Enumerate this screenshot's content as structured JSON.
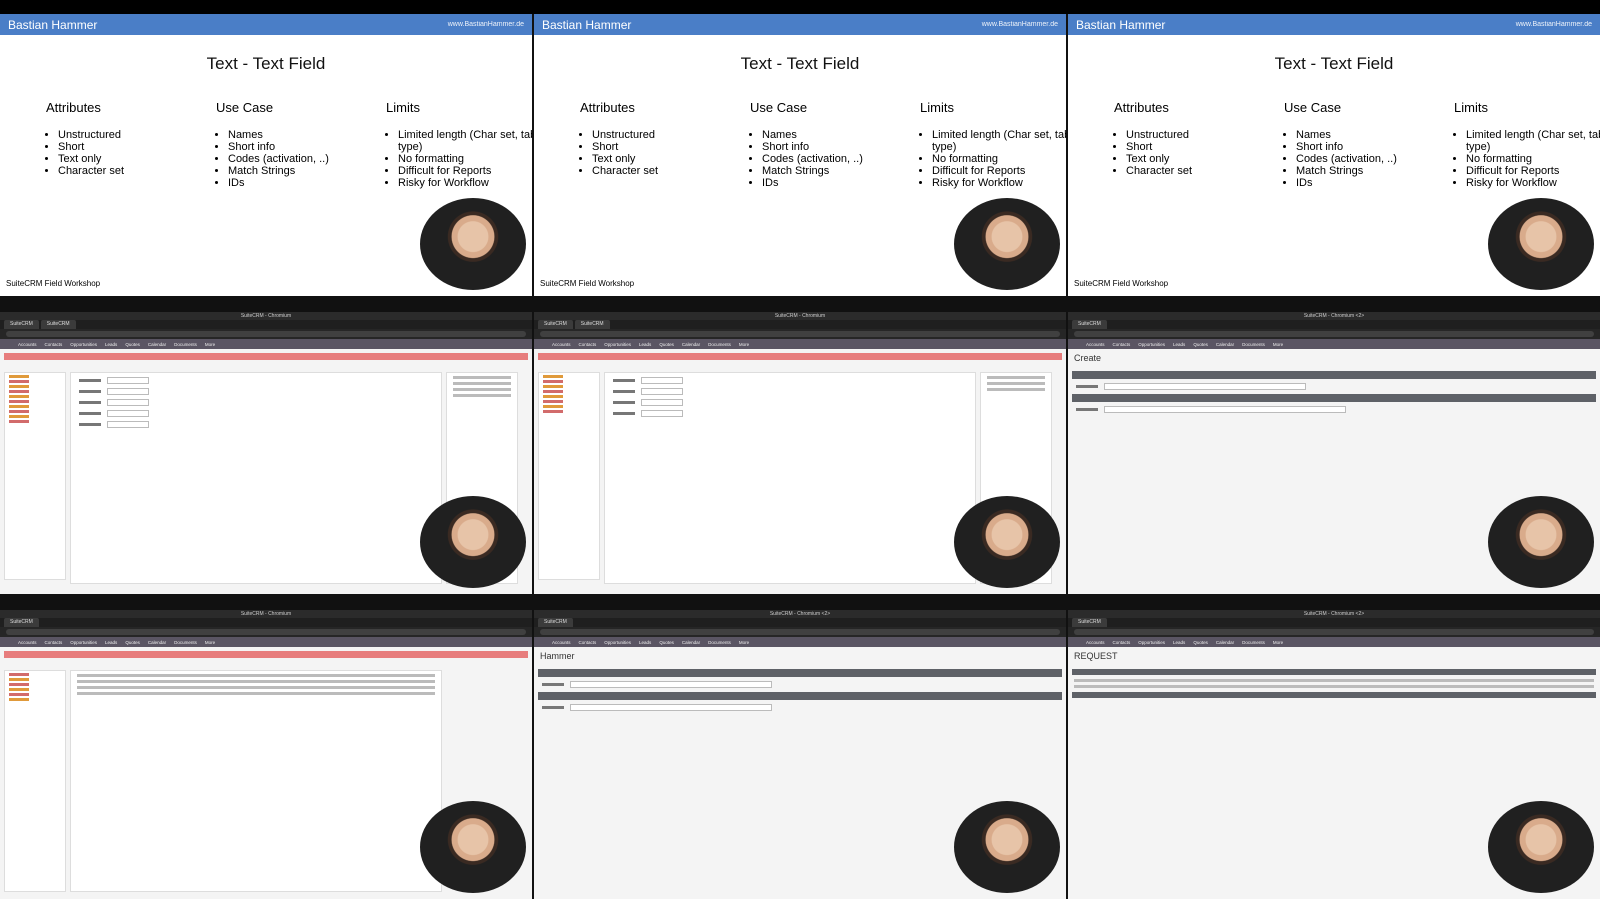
{
  "slides": [
    {
      "brand": "Bastian Hammer",
      "site": "www.BastianHammer.de",
      "title": "Text - Text Field",
      "attributes_title": "Attributes",
      "attributes": [
        "Unstructured",
        "Short",
        "Text only",
        "Character set"
      ],
      "usecase_title": "Use Case",
      "usecase": [
        "Names",
        "Short info",
        "Codes (activation, ..)",
        "Match Strings",
        "IDs"
      ],
      "limits_title": "Limits",
      "limits": [
        "Limited length (Char set, table type)",
        "No formatting",
        "Difficult for Reports",
        "Risky for Workflow"
      ],
      "footer": "SuiteCRM Field Workshop"
    }
  ],
  "screens": {
    "window_title": "SuiteCRM - Chromium",
    "window_title_2": "SuiteCRM - Chromium <2>",
    "tab_label": "SuiteCRM",
    "nav_items": [
      "Accounts",
      "Contacts",
      "Opportunities",
      "Leads",
      "Quotes",
      "Calendar",
      "Documents",
      "More"
    ],
    "create_title": "Create",
    "hammer_title": "Hammer",
    "request_title": "REQUEST"
  }
}
